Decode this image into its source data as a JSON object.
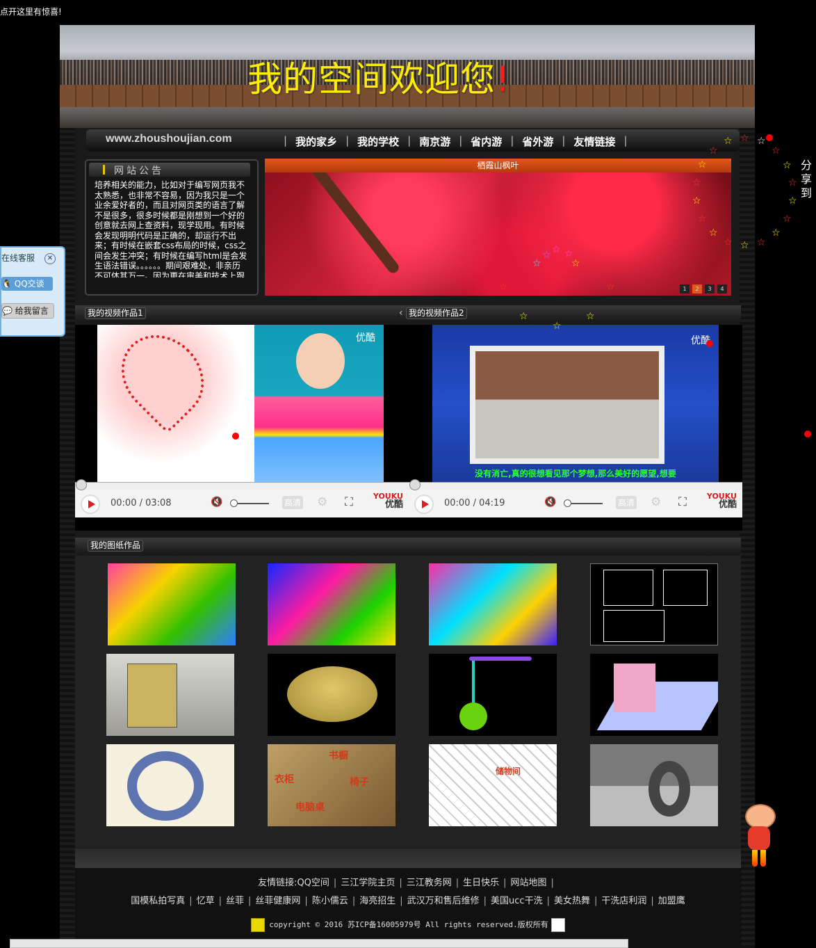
{
  "top_link": "点开这里有惊喜!",
  "banner": {
    "title": "我的空间欢迎您",
    "exclaim": "!"
  },
  "nav": {
    "site_url": "www.zhoushoujian.com",
    "items": [
      "我的家乡",
      "我的学校",
      "南京游",
      "省内游",
      "省外游",
      "友情链接"
    ]
  },
  "notice": {
    "title": "网站公告",
    "text": "培养相关的能力，比如对于编写网页我不太熟悉，也非常不容易，因为我只是一个业余爱好者的，而且对网页类的语言了解不是很多，很多时候都是刚想到一个好的创意就去网上查资料，现学现用。有时候会发现明明代码是正确的，却运行不出来；有时候在嵌套css布局的时候，css之间会发生冲突；有时候在编写html是会发生语法错误。。。。。。期间艰难处，非亲历不可体其万一。因为更在审美和技术上跟得上时代（毕竟已经是第三次改版了），所以必须要把网页做得漂亮，把网站布局设计得完美"
  },
  "slider": {
    "caption": "栖霞山枫叶",
    "dots": [
      "1",
      "2",
      "3",
      "4"
    ],
    "active_dot": 2
  },
  "sections": {
    "video1": "我的视频作品1",
    "video2": "我的视频作品2",
    "gallery": "我的图纸作品"
  },
  "videos": [
    {
      "time": "00:00 / 03:08",
      "hd": "高清",
      "brand_en": "YOUKU",
      "brand_cn": "优酷",
      "watermark": "优酷"
    },
    {
      "time": "00:00 / 04:19",
      "hd": "高清",
      "brand_en": "YOUKU",
      "brand_cn": "优酷",
      "watermark": "优酷",
      "subtitle": "没有消亡,真的很想看见那个梦想,那么美好的愿望,想要"
    }
  ],
  "gallery": [
    {
      "kind": "collage-1",
      "colors": [
        "#ff3fa0",
        "#f8d200",
        "#33c000",
        "#2e7dff"
      ]
    },
    {
      "kind": "collage-2",
      "colors": [
        "#1428ff",
        "#ff1ca0",
        "#1bd200",
        "#ffe100"
      ]
    },
    {
      "kind": "collage-3",
      "colors": [
        "#ff2aa8",
        "#00e0ff",
        "#ffd000",
        "#3a1fff"
      ]
    },
    {
      "kind": "cad-drawing",
      "colors": [
        "#000000",
        "#ffffff"
      ]
    },
    {
      "kind": "building-model",
      "colors": [
        "#b8b8b0",
        "#c9b360"
      ]
    },
    {
      "kind": "coin-model",
      "colors": [
        "#000000",
        "#c3a44a"
      ]
    },
    {
      "kind": "pendulum-model",
      "colors": [
        "#000000",
        "#6bd20f",
        "#8a4ad8"
      ]
    },
    {
      "kind": "pink-house",
      "colors": [
        "#000000",
        "#f1a7c8",
        "#b7c4ff"
      ]
    },
    {
      "kind": "wire-torus",
      "colors": [
        "#f5f1de",
        "#2a4aa0"
      ]
    },
    {
      "kind": "furniture-room",
      "colors": [
        "#c0a066",
        "#d33a1a"
      ],
      "labels": [
        "书橱",
        "衣柜",
        "电脑桌",
        "椅子"
      ]
    },
    {
      "kind": "floor-plan",
      "colors": [
        "#ffffff",
        "#333333"
      ],
      "labels": [
        "储物间"
      ]
    },
    {
      "kind": "tire-model",
      "colors": [
        "#8f8f8f",
        "#444444"
      ]
    }
  ],
  "footer": {
    "friends_label": "友情链接:",
    "friends_row1": [
      "QQ空间",
      "三江学院主页",
      "三江教务网",
      "生日快乐",
      "网站地图"
    ],
    "friends_row2": [
      "国模私拍写真",
      "忆草",
      "丝菲",
      "丝菲健康网",
      "陈小儒云",
      "海亮招生",
      "武汉万和售后维修",
      "美国ucc干洗",
      "美女热舞",
      "干洗店利润",
      "加盟鹰"
    ],
    "copyright": "copyright © 2016 苏ICP备16005979号 All rights reserved.版权所有"
  },
  "kefu": {
    "title": "在线客服",
    "qq_label": "QQ交谈",
    "msg_label": "给我留言"
  },
  "share": "分享到",
  "colors": {
    "accent_yellow": "#ffee00",
    "accent_red": "#ff1a1a",
    "slider_orange": "#e2581a",
    "qq_blue": "#5a9fd8"
  }
}
